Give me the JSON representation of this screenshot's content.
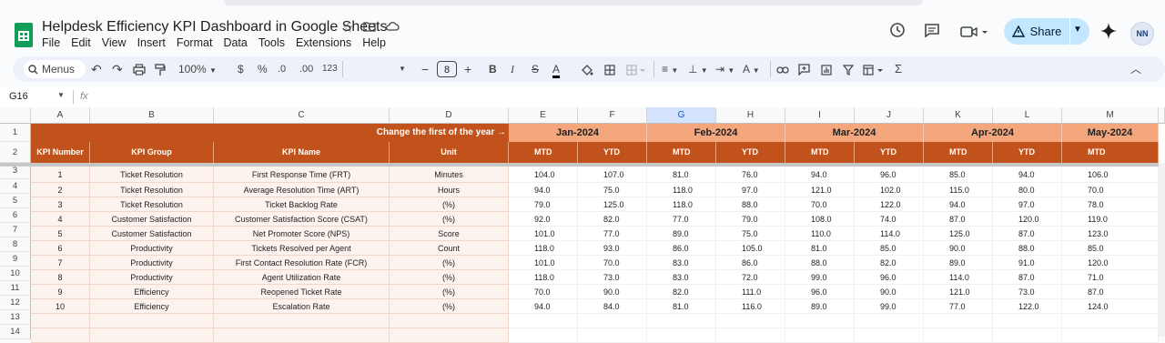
{
  "app": {
    "doc_title": "Helpdesk Efficiency KPI Dashboard in Google Sheets",
    "menu": [
      "File",
      "Edit",
      "View",
      "Insert",
      "Format",
      "Data",
      "Tools",
      "Extensions",
      "Help"
    ],
    "share_label": "Share"
  },
  "toolbar": {
    "menus_label": "Menus",
    "zoom": "100%",
    "currency": "$",
    "percent": "%",
    "dec_less": ".0",
    "dec_more": ".00",
    "number_format": "123",
    "font_size": "8"
  },
  "formula_bar": {
    "cell_ref": "G16",
    "fx": "fx"
  },
  "columns": [
    "A",
    "B",
    "C",
    "D",
    "E",
    "F",
    "G",
    "H",
    "I",
    "J",
    "K",
    "L",
    "M"
  ],
  "selected_column": "G",
  "sheet": {
    "banner": "Change the first of the year →",
    "months": [
      "Jan-2024",
      "Feb-2024",
      "Mar-2024",
      "Apr-2024",
      "May-2024"
    ],
    "headers": [
      "KPI Number",
      "KPI Group",
      "KPI Name",
      "Unit"
    ],
    "sub_headers": [
      "MTD",
      "YTD",
      "MTD",
      "YTD",
      "MTD",
      "YTD",
      "MTD",
      "YTD",
      "MTD"
    ],
    "row_numbers": [
      "1",
      "2",
      "3",
      "4",
      "5",
      "6",
      "7",
      "8",
      "9",
      "10",
      "11",
      "12",
      "13",
      "14"
    ],
    "rows": [
      [
        "1",
        "Ticket Resolution",
        "First Response Time (FRT)",
        "Minutes",
        "104.0",
        "107.0",
        "81.0",
        "76.0",
        "94.0",
        "96.0",
        "85.0",
        "94.0",
        "106.0"
      ],
      [
        "2",
        "Ticket Resolution",
        "Average Resolution Time (ART)",
        "Hours",
        "94.0",
        "75.0",
        "118.0",
        "97.0",
        "121.0",
        "102.0",
        "115.0",
        "80.0",
        "70.0"
      ],
      [
        "3",
        "Ticket Resolution",
        "Ticket Backlog Rate",
        "(%)",
        "79.0",
        "125.0",
        "118.0",
        "88.0",
        "70.0",
        "122.0",
        "94.0",
        "97.0",
        "78.0"
      ],
      [
        "4",
        "Customer Satisfaction",
        "Customer Satisfaction Score (CSAT)",
        "(%)",
        "92.0",
        "82.0",
        "77.0",
        "79.0",
        "108.0",
        "74.0",
        "87.0",
        "120.0",
        "119.0"
      ],
      [
        "5",
        "Customer Satisfaction",
        "Net Promoter Score (NPS)",
        "Score",
        "101.0",
        "77.0",
        "89.0",
        "75.0",
        "110.0",
        "114.0",
        "125.0",
        "87.0",
        "123.0"
      ],
      [
        "6",
        "Productivity",
        "Tickets Resolved per Agent",
        "Count",
        "118.0",
        "93.0",
        "86.0",
        "105.0",
        "81.0",
        "85.0",
        "90.0",
        "88.0",
        "85.0"
      ],
      [
        "7",
        "Productivity",
        "First Contact Resolution Rate (FCR)",
        "(%)",
        "101.0",
        "70.0",
        "83.0",
        "86.0",
        "88.0",
        "82.0",
        "89.0",
        "91.0",
        "120.0"
      ],
      [
        "8",
        "Productivity",
        "Agent Utilization Rate",
        "(%)",
        "118.0",
        "73.0",
        "83.0",
        "72.0",
        "99.0",
        "96.0",
        "114.0",
        "87.0",
        "71.0"
      ],
      [
        "9",
        "Efficiency",
        "Reopened Ticket Rate",
        "(%)",
        "70.0",
        "90.0",
        "82.0",
        "111.0",
        "96.0",
        "90.0",
        "121.0",
        "73.0",
        "87.0"
      ],
      [
        "10",
        "Efficiency",
        "Escalation Rate",
        "(%)",
        "94.0",
        "84.0",
        "81.0",
        "116.0",
        "89.0",
        "99.0",
        "77.0",
        "122.0",
        "124.0"
      ]
    ]
  }
}
